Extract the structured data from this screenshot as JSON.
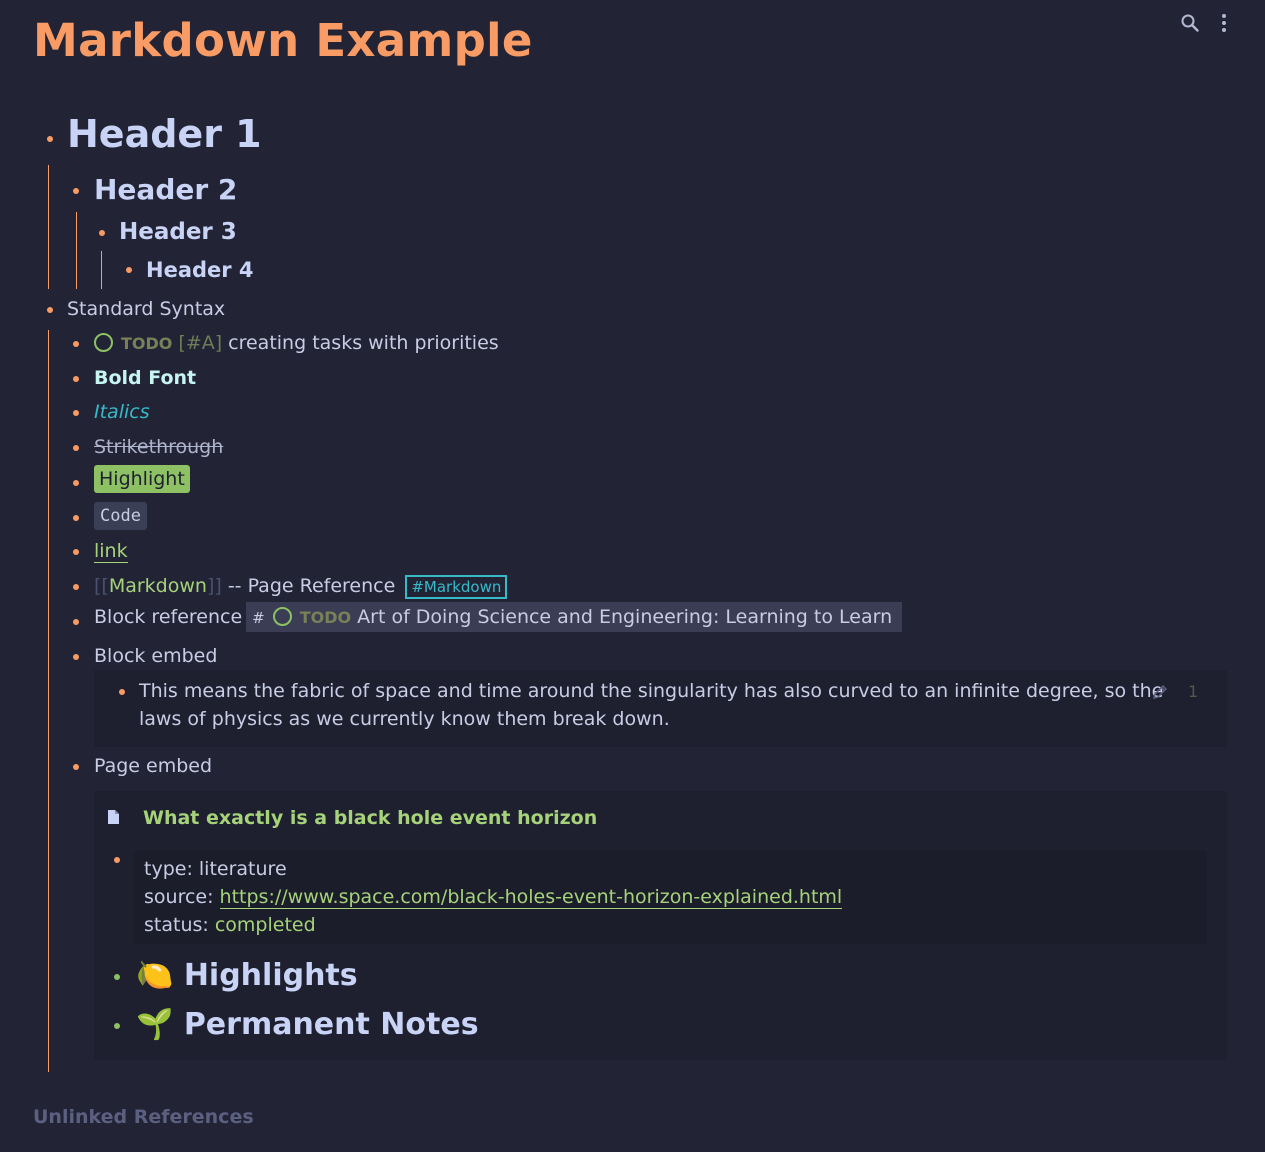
{
  "page": {
    "title": "Markdown Example"
  },
  "toolbar": {
    "search_icon": "search-icon",
    "more_icon": "more-vertical-icon"
  },
  "headers": {
    "h1": "Header 1",
    "h2": "Header 2",
    "h3": "Header 3",
    "h4": "Header 4"
  },
  "standard": {
    "label": "Standard Syntax",
    "todo": {
      "keyword": "TODO",
      "priority": "[#A]",
      "text": "creating tasks with priorities"
    },
    "bold": "Bold Font",
    "italic": "Italics",
    "strike": "Strikethrough",
    "highlight": "Highlight",
    "code": "Code",
    "link": "link",
    "pageref": {
      "open": "[[",
      "name": "Markdown",
      "close": "]]",
      "suffix": "-- Page Reference",
      "tag": "#Markdown"
    },
    "blockref": {
      "label": "Block reference",
      "hash": "#",
      "keyword": "TODO",
      "text": "Art of Doing Science and Engineering: Learning to Learn"
    },
    "blockembed": {
      "label": "Block embed",
      "line1": "This means the fabric of space and time around the singularity has also curved to an infinite degree, so the",
      "line2": "laws of physics as we currently know them break down.",
      "count": "1"
    },
    "pageembed": {
      "label": "Page embed",
      "title": "What exactly is a black hole event horizon",
      "props": {
        "type_key": "type:",
        "type_val": "literature",
        "source_key": "source:",
        "source_val": "https://www.space.com/black-holes-event-horizon-explained.html",
        "status_key": "status:",
        "status_val": "completed"
      },
      "highlights_emoji": "🍋",
      "highlights": "Highlights",
      "notes_emoji": "🌱",
      "notes": "Permanent Notes"
    }
  },
  "footer": {
    "unlinked": "Unlinked References"
  },
  "colors": {
    "background": "#222436",
    "accent": "#f99b65",
    "green": "#8dc163",
    "cyan": "#37b9c8"
  }
}
